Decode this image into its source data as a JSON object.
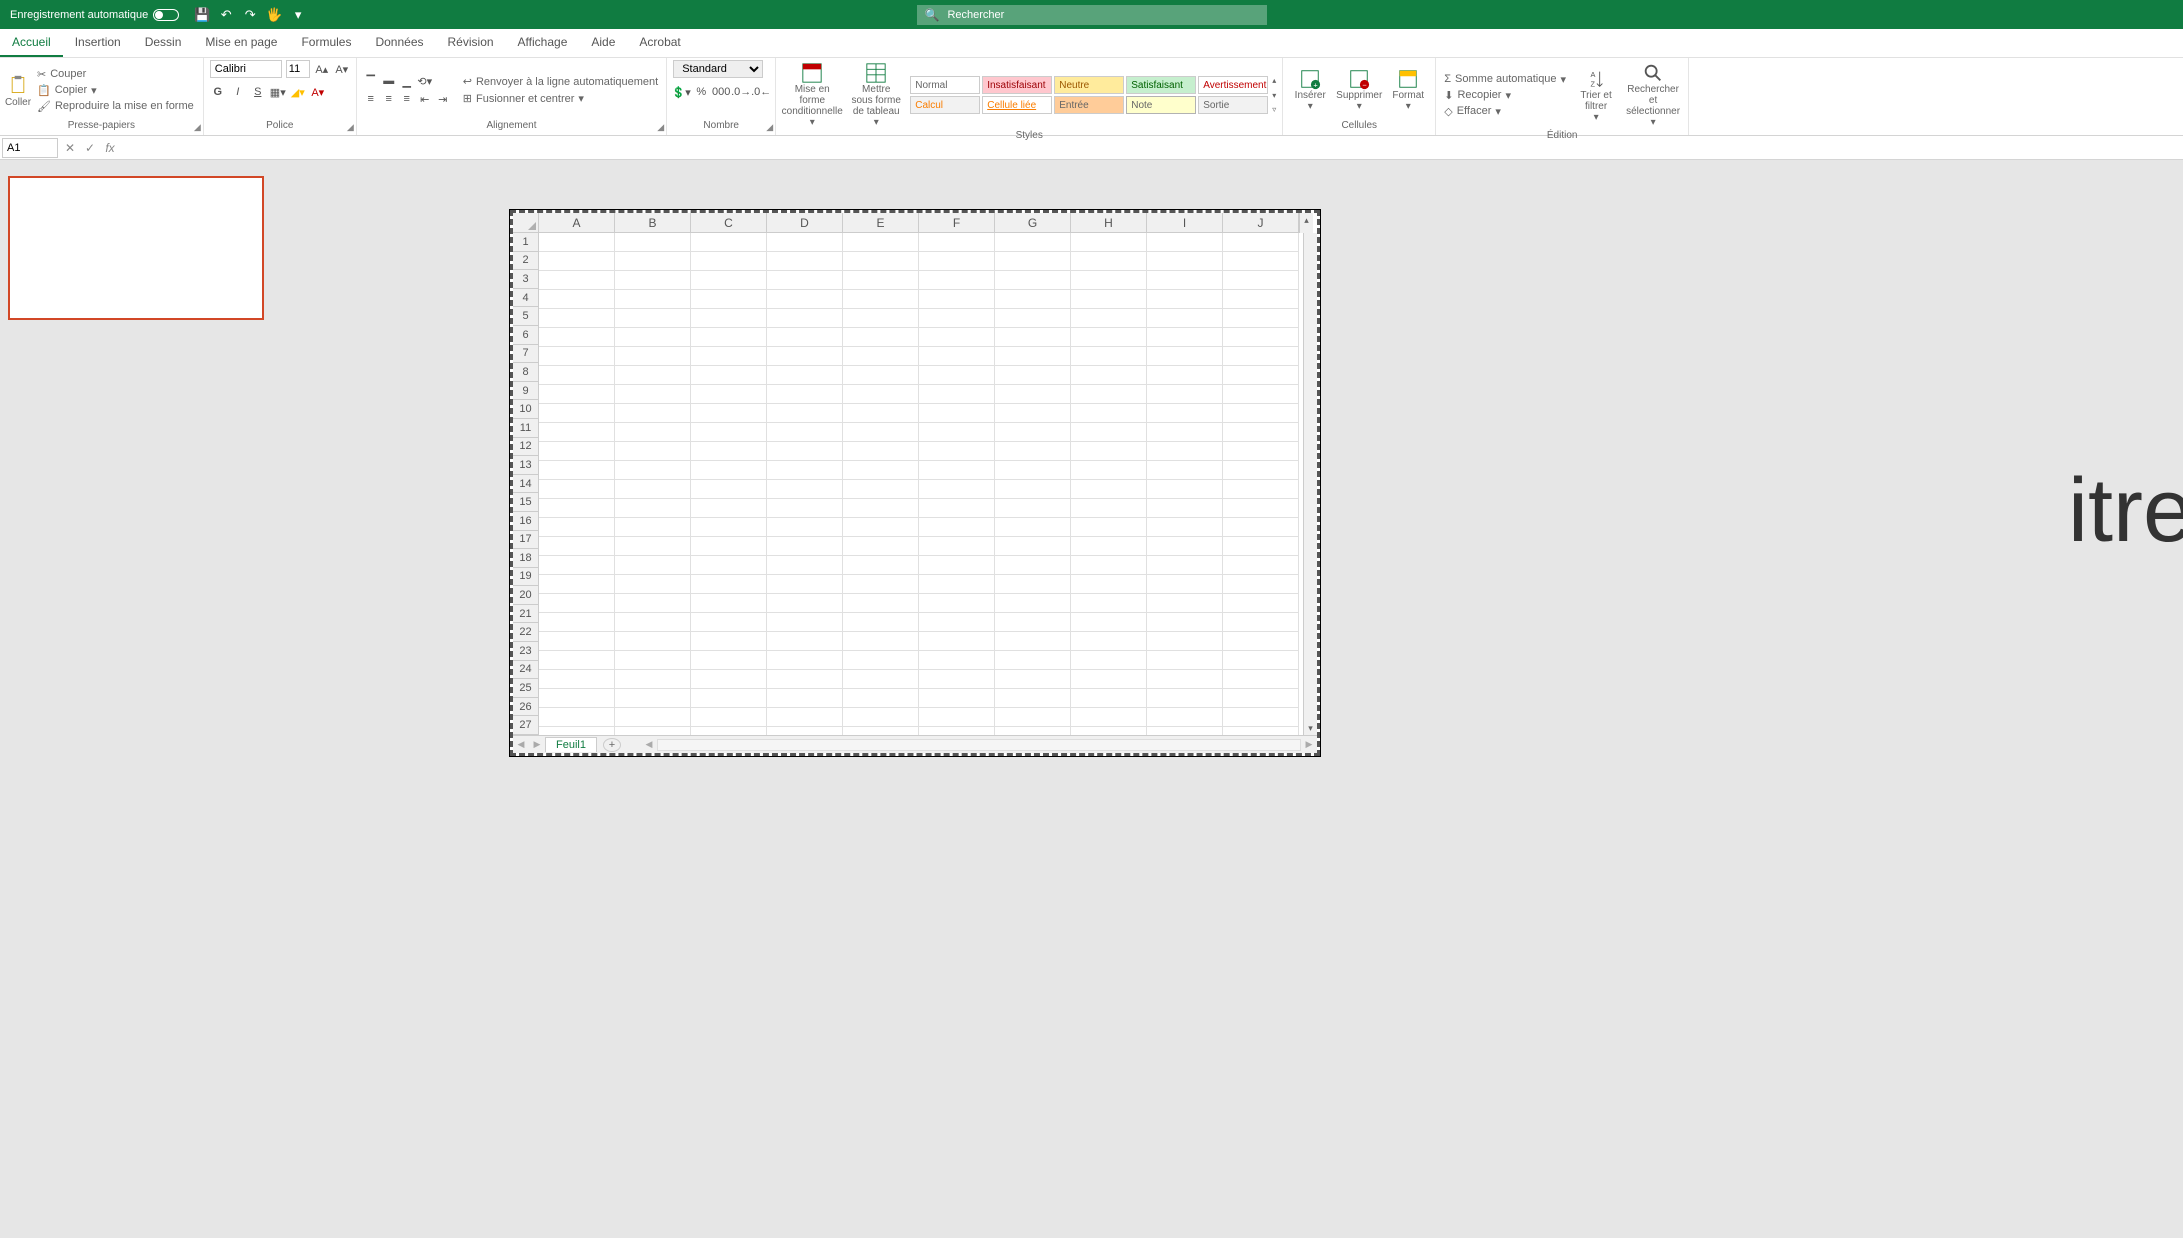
{
  "titlebar": {
    "autosave_label": "Enregistrement automatique",
    "search_placeholder": "Rechercher"
  },
  "tabs": [
    "Accueil",
    "Insertion",
    "Dessin",
    "Mise en page",
    "Formules",
    "Données",
    "Révision",
    "Affichage",
    "Aide",
    "Acrobat"
  ],
  "active_tab": "Accueil",
  "ribbon": {
    "clipboard": {
      "label": "Presse-papiers",
      "paste": "Coller",
      "cut": "Couper",
      "copy": "Copier",
      "format_painter": "Reproduire la mise en forme"
    },
    "font": {
      "label": "Police",
      "name": "Calibri",
      "size": "11",
      "bold": "G",
      "italic": "I",
      "underline": "S"
    },
    "alignment": {
      "label": "Alignement",
      "wrap": "Renvoyer à la ligne automatiquement",
      "merge": "Fusionner et centrer"
    },
    "number": {
      "label": "Nombre",
      "format": "Standard"
    },
    "conditional": "Mise en forme conditionnelle",
    "as_table": "Mettre sous forme de tableau",
    "styles": {
      "label": "Styles",
      "items": [
        {
          "txt": "Normal",
          "cls": "style-normal"
        },
        {
          "txt": "Insatisfaisant",
          "cls": "style-bad"
        },
        {
          "txt": "Neutre",
          "cls": "style-neutral"
        },
        {
          "txt": "Satisfaisant",
          "cls": "style-good"
        },
        {
          "txt": "Avertissement",
          "cls": "style-warning"
        },
        {
          "txt": "Calcul",
          "cls": "style-calc"
        },
        {
          "txt": "Cellule liée",
          "cls": "style-linked"
        },
        {
          "txt": "Entrée",
          "cls": "style-input"
        },
        {
          "txt": "Note",
          "cls": "style-note"
        },
        {
          "txt": "Sortie",
          "cls": "style-output"
        }
      ]
    },
    "cells": {
      "label": "Cellules",
      "insert": "Insérer",
      "delete": "Supprimer",
      "format": "Format"
    },
    "editing": {
      "label": "Édition",
      "sum": "Somme automatique",
      "fill": "Recopier",
      "clear": "Effacer",
      "sort": "Trier et filtrer",
      "find": "Rechercher et sélectionner"
    }
  },
  "formula_bar": {
    "name_box": "A1"
  },
  "sheet": {
    "columns": [
      "A",
      "B",
      "C",
      "D",
      "E",
      "F",
      "G",
      "H",
      "I",
      "J"
    ],
    "rows": [
      "1",
      "2",
      "3",
      "4",
      "5",
      "6",
      "7",
      "8",
      "9",
      "10",
      "11",
      "12",
      "13",
      "14",
      "15",
      "16",
      "17",
      "18",
      "19",
      "20",
      "21",
      "22",
      "23",
      "24",
      "25",
      "26",
      "27"
    ],
    "tab_name": "Feuil1"
  },
  "bg_text": "itre"
}
